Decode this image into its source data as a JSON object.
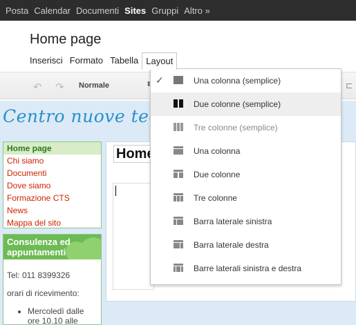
{
  "topbar": {
    "items": [
      {
        "label": "Posta",
        "active": false
      },
      {
        "label": "Calendar",
        "active": false
      },
      {
        "label": "Documenti",
        "active": false
      },
      {
        "label": "Sites",
        "active": true
      },
      {
        "label": "Gruppi",
        "active": false
      },
      {
        "label": "Altro »",
        "active": false
      }
    ]
  },
  "page": {
    "title": "Home page"
  },
  "menubar": {
    "items": [
      {
        "label": "Inserisci"
      },
      {
        "label": "Formato"
      },
      {
        "label": "Tabella"
      },
      {
        "label": "Layout",
        "open": true
      }
    ]
  },
  "toolbar": {
    "undo_icon": "undo-icon",
    "redo_icon": "redo-icon",
    "style_value": "Normale"
  },
  "site": {
    "title": "Centro nuove tecnolog",
    "nav": [
      {
        "label": "Home page",
        "current": true
      },
      {
        "label": "Chi siamo"
      },
      {
        "label": "Documenti"
      },
      {
        "label": "Dove siamo"
      },
      {
        "label": "Formazione CTS"
      },
      {
        "label": "News"
      },
      {
        "label": "Mappa del sito"
      }
    ],
    "contact": {
      "header": "Consulenza ed appuntamenti",
      "phone": "Tel: 011 8399326",
      "hours_label": "orari di ricevimento:",
      "list": [
        "Mercoledì dalle ore 10.10 alle"
      ]
    },
    "content_heading": "Home"
  },
  "layout_menu": {
    "items": [
      {
        "label": "Una colonna (semplice)",
        "checked": true,
        "icon": "one-column-simple-icon"
      },
      {
        "label": "Due colonne (semplice)",
        "hover": true,
        "icon": "two-columns-simple-icon"
      },
      {
        "label": "Tre colonne (semplice)",
        "disabled": true,
        "icon": "three-columns-simple-icon"
      },
      {
        "label": "Una colonna",
        "icon": "one-column-icon"
      },
      {
        "label": "Due colonne",
        "icon": "two-columns-icon"
      },
      {
        "label": "Tre colonne",
        "icon": "three-columns-icon"
      },
      {
        "label": "Barra laterale sinistra",
        "icon": "left-sidebar-icon"
      },
      {
        "label": "Barra laterale destra",
        "icon": "right-sidebar-icon"
      },
      {
        "label": "Barre laterali sinistra e destra",
        "icon": "both-sidebars-icon"
      }
    ]
  },
  "colors": {
    "topbar_bg": "#2d2d2d",
    "site_title": "#2b8fc8",
    "nav_link": "#cc2200",
    "sidebar_border": "#8bc38b",
    "contact_header": "#6dbb55"
  }
}
